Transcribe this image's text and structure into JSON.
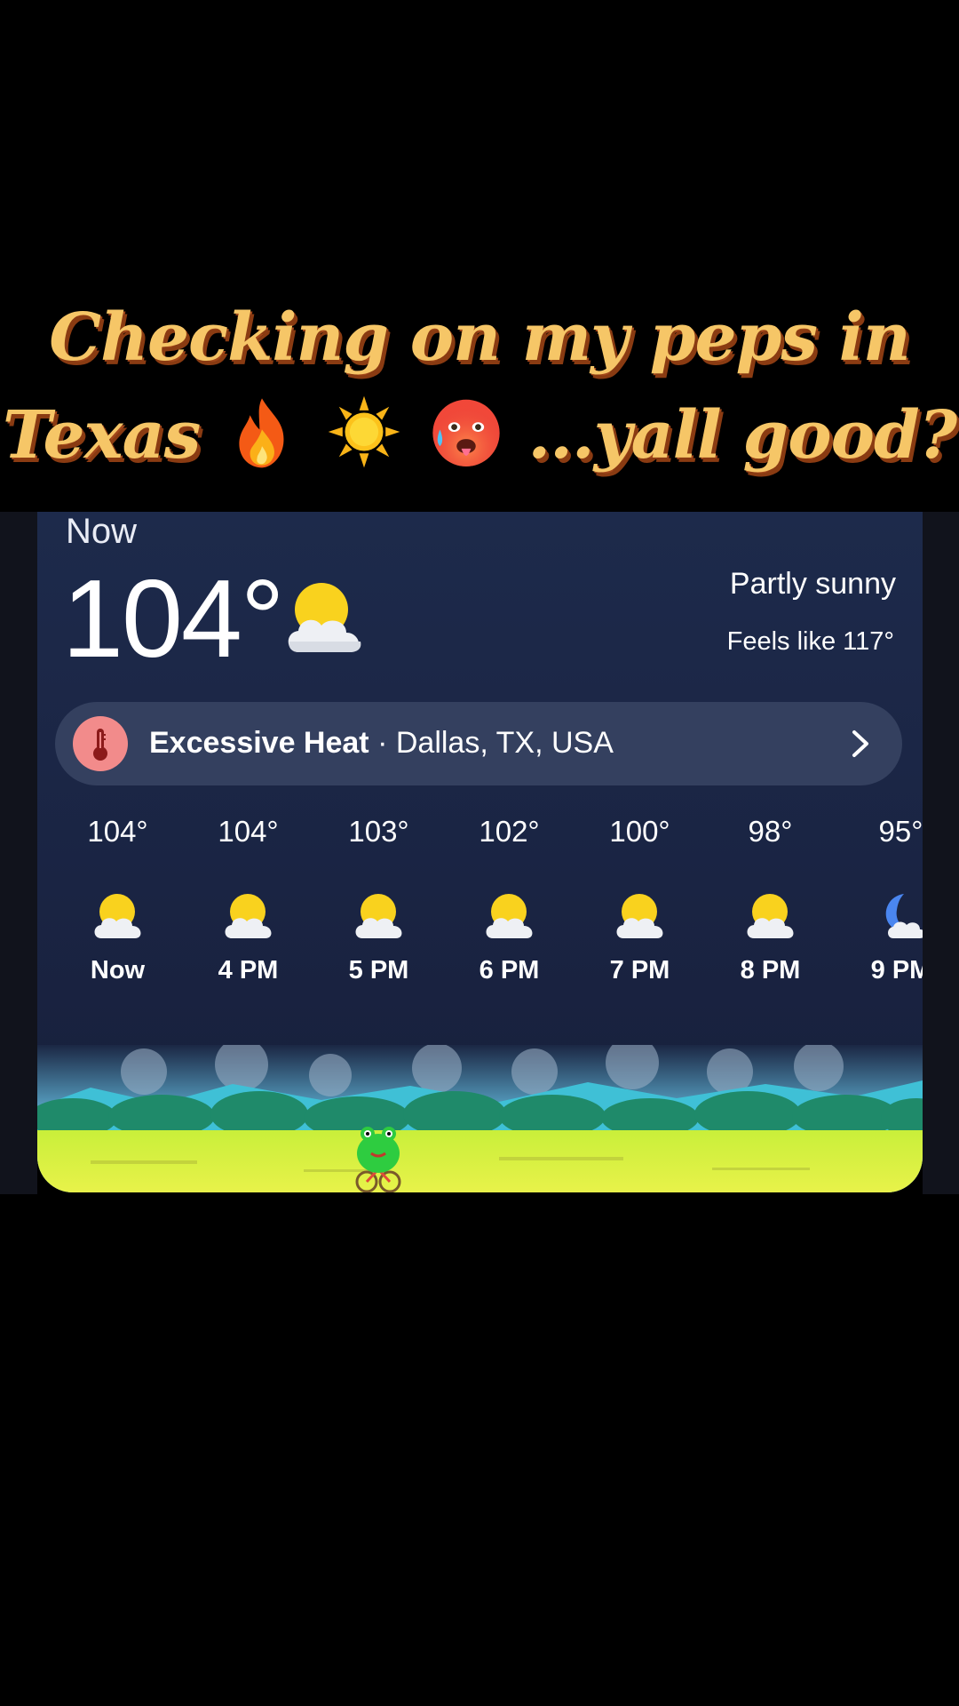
{
  "caption": {
    "line1": "Checking on my peps in",
    "line2_start": "Texas",
    "line2_end": "...yall good?",
    "emojis": [
      "fire-emoji",
      "sun-emoji",
      "hot-face-emoji"
    ]
  },
  "weather": {
    "now_label": "Now",
    "temperature": "104°",
    "condition": "Partly sunny",
    "feels_like": "Feels like 117°",
    "current_icon": "partly-sunny-icon",
    "alert": {
      "title": "Excessive Heat",
      "separator": " · ",
      "location": "Dallas, TX, USA",
      "icon": "thermometer-icon"
    },
    "hourly": [
      {
        "temp": "104°",
        "label": "Now",
        "icon": "partly-sunny-icon"
      },
      {
        "temp": "104°",
        "label": "4 PM",
        "icon": "partly-sunny-icon"
      },
      {
        "temp": "103°",
        "label": "5 PM",
        "icon": "partly-sunny-icon"
      },
      {
        "temp": "102°",
        "label": "6 PM",
        "icon": "partly-sunny-icon"
      },
      {
        "temp": "100°",
        "label": "7 PM",
        "icon": "partly-sunny-icon"
      },
      {
        "temp": "98°",
        "label": "8 PM",
        "icon": "partly-sunny-icon"
      },
      {
        "temp": "95°",
        "label": "9 PM",
        "icon": "partly-cloudy-night-icon"
      }
    ]
  },
  "colors": {
    "caption_fill": "#f6c667",
    "caption_shadow": "#8a3b12",
    "card_bg": "#1d2a4b",
    "alert_bg": "#34405f",
    "alert_icon_bg": "#f28b8b",
    "sun_yellow": "#f9d21e"
  }
}
